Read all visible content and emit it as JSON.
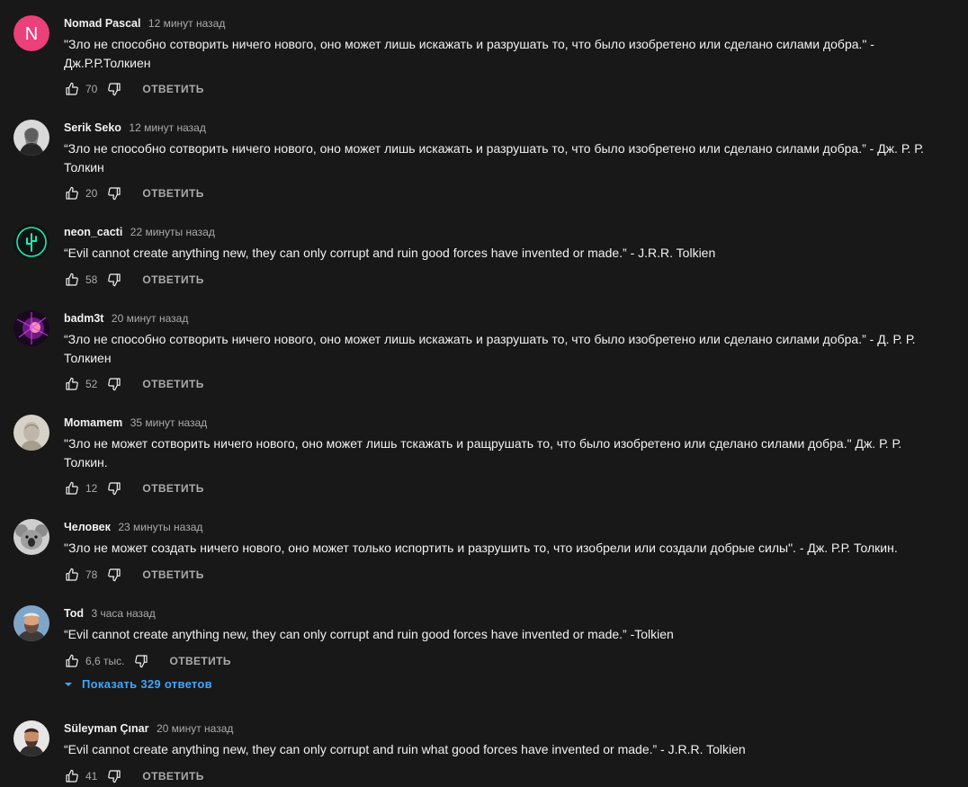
{
  "labels": {
    "reply": "ОТВЕТИТЬ"
  },
  "comments": [
    {
      "author": "Nomad Pascal",
      "time": "12 минут назад",
      "text_lines": [
        "\"Зло не способно сотворить ничего нового, оно может лишь искажать и разрушать то, что было изобретено или сделано силами добра.\" -",
        "Дж.Р.Р.Толкиен"
      ],
      "likes": "70",
      "avatar": {
        "type": "letter",
        "letter": "N",
        "color": "#ec407a"
      }
    },
    {
      "author": "Serik Seko",
      "time": "12 минут назад",
      "text_lines": [
        "“Зло не способно сотворить ничего нового, оно может лишь искажать и разрушать то, что было изобретено или сделано силами добра.” - Дж. Р. Р.",
        "Толкин"
      ],
      "likes": "20",
      "avatar": {
        "type": "photo",
        "icon": "person-portrait-icon",
        "color": "#bdbdbd"
      }
    },
    {
      "author": "neon_cacti",
      "time": "22 минуты назад",
      "text_lines": [
        "“Evil cannot create anything new, they can only corrupt and ruin good forces have invented or made.” - J.R.R. Tolkien"
      ],
      "likes": "58",
      "avatar": {
        "type": "neon-cactus",
        "icon": "neon-cactus-icon",
        "color": "#1de9b6"
      }
    },
    {
      "author": "badm3t",
      "time": "20 минут назад",
      "text_lines": [
        "“Зло не способно сотворить ничего нового, оно может лишь искажать и разрушать то, что было изобретено или сделано силами добра.” - Д. Р. Р.",
        "Толкиен"
      ],
      "likes": "52",
      "avatar": {
        "type": "abstract",
        "icon": "purple-burst-icon",
        "color": "#c2185b"
      }
    },
    {
      "author": "Momamem",
      "time": "35 минут назад",
      "text_lines": [
        "\"Зло не может сотворить ничего нового, оно может лишь тскажать и ращрушать то, что было изобретено или сделано силами добра.\" Дж. Р. Р.",
        "Толкин."
      ],
      "likes": "12",
      "avatar": {
        "type": "photo",
        "icon": "sketch-portrait-icon",
        "color": "#d7d2c8"
      }
    },
    {
      "author": "Человек",
      "time": "23 минуты назад",
      "text_lines": [
        "\"Зло не может создать ничего нового, оно может только испортить и разрушить то, что изобрели или создали добрые силы\". - Дж. Р.Р. Толкин."
      ],
      "likes": "78",
      "avatar": {
        "type": "photo",
        "icon": "koala-icon",
        "color": "#9e9e9e"
      }
    },
    {
      "author": "Tod",
      "time": "3 часа назад",
      "text_lines": [
        "“Evil cannot create anything new, they can only corrupt and ruin good forces have invented or made.” -Tolkien"
      ],
      "likes": "6,6 тыс.",
      "replies": "Показать 329 ответов",
      "avatar": {
        "type": "photo",
        "icon": "bearded-man-icon",
        "color": "#8d6e63"
      }
    },
    {
      "author": "Süleyman Çınar",
      "time": "20 минут назад",
      "text_lines": [
        "“Evil cannot create anything new, they can only corrupt and ruin what good forces have invented or made.” - J.R.R. Tolkien"
      ],
      "likes": "41",
      "avatar": {
        "type": "photo",
        "icon": "man-portrait-icon",
        "color": "#795548"
      }
    }
  ]
}
